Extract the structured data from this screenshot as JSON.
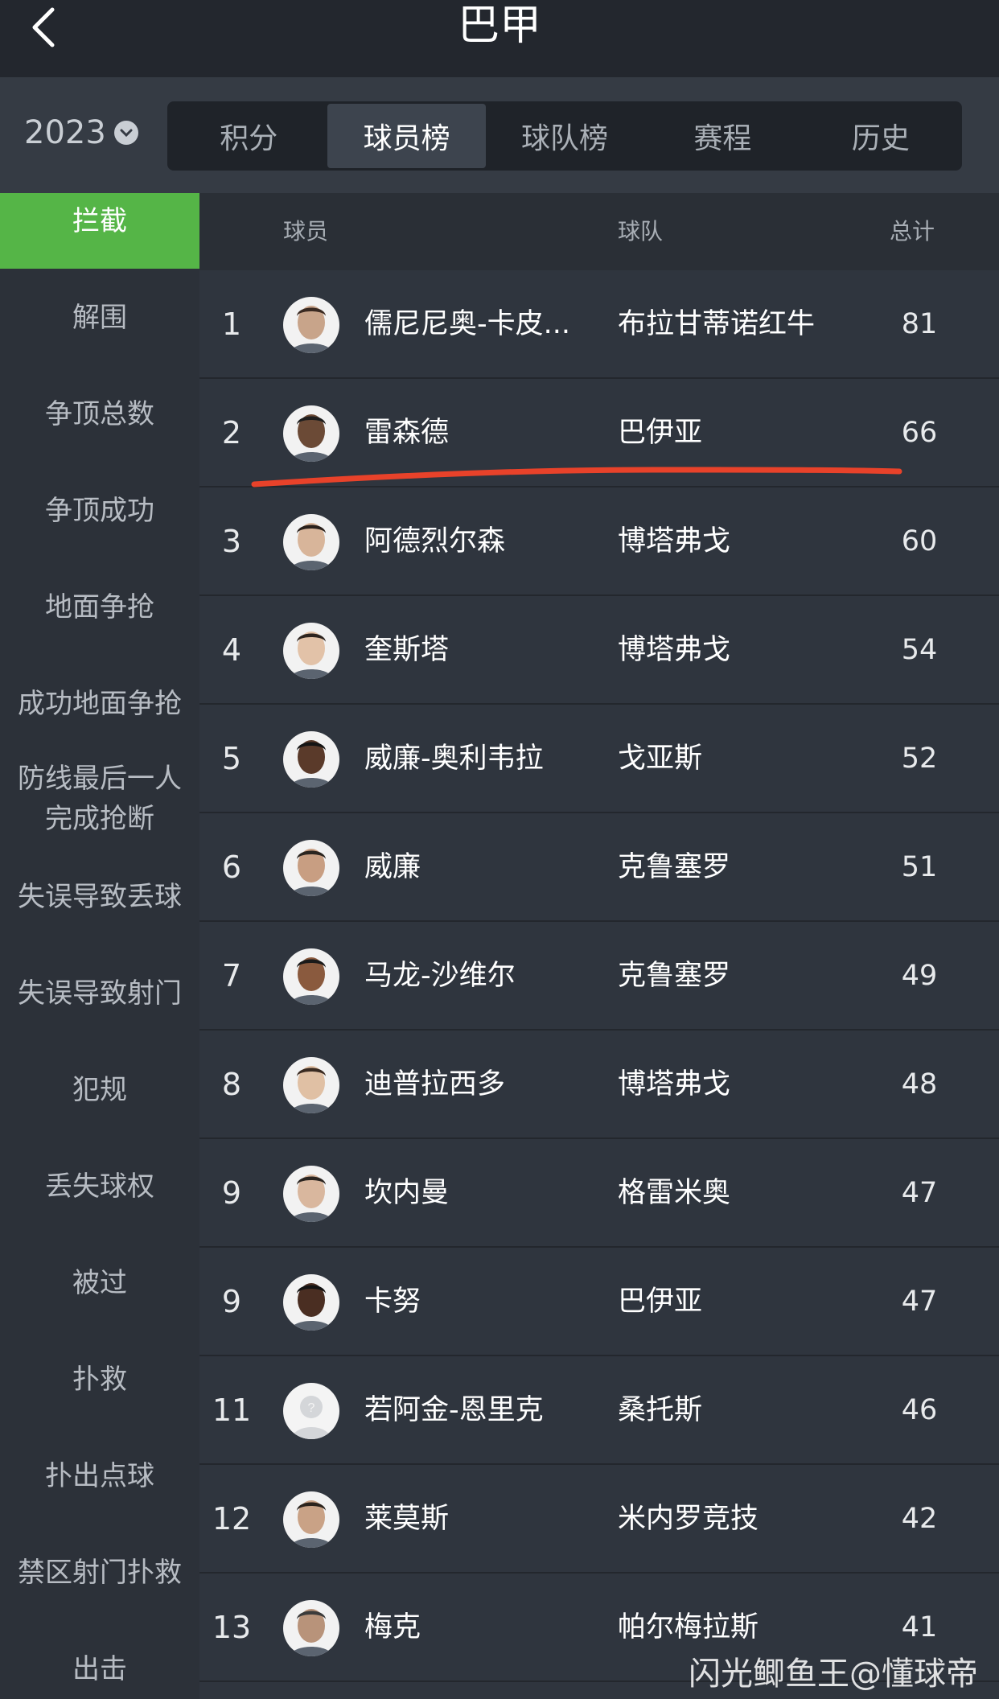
{
  "header": {
    "title": "巴甲"
  },
  "filter": {
    "year": "2023",
    "tabs": [
      {
        "label": "积分",
        "active": false
      },
      {
        "label": "球员榜",
        "active": true
      },
      {
        "label": "球队榜",
        "active": false
      },
      {
        "label": "赛程",
        "active": false
      },
      {
        "label": "历史",
        "active": false
      }
    ]
  },
  "sidebar": {
    "items": [
      {
        "label": "拦截",
        "active": true
      },
      {
        "label": "解围"
      },
      {
        "label": "争顶总数"
      },
      {
        "label": "争顶成功"
      },
      {
        "label": "地面争抢"
      },
      {
        "label": "成功地面争抢"
      },
      {
        "label": "防线最后一人完成抢断",
        "line1": "防线最后一人",
        "line2": "完成抢断"
      },
      {
        "label": "失误导致丢球"
      },
      {
        "label": "失误导致射门"
      },
      {
        "label": "犯规"
      },
      {
        "label": "丢失球权"
      },
      {
        "label": "被过"
      },
      {
        "label": "扑救"
      },
      {
        "label": "扑出点球"
      },
      {
        "label": "禁区射门扑救"
      },
      {
        "label": "出击"
      }
    ]
  },
  "table": {
    "columns": {
      "player": "球员",
      "team": "球队",
      "total": "总计"
    },
    "rows": [
      {
        "rank": "1",
        "player": "儒尼尼奥-卡皮...",
        "team": "布拉甘蒂诺红牛",
        "total": "81"
      },
      {
        "rank": "2",
        "player": "雷森德",
        "team": "巴伊亚",
        "total": "66"
      },
      {
        "rank": "3",
        "player": "阿德烈尔森",
        "team": "博塔弗戈",
        "total": "60"
      },
      {
        "rank": "4",
        "player": "奎斯塔",
        "team": "博塔弗戈",
        "total": "54"
      },
      {
        "rank": "5",
        "player": "威廉-奥利韦拉",
        "team": "戈亚斯",
        "total": "52"
      },
      {
        "rank": "6",
        "player": "威廉",
        "team": "克鲁塞罗",
        "total": "51"
      },
      {
        "rank": "7",
        "player": "马龙-沙维尔",
        "team": "克鲁塞罗",
        "total": "49"
      },
      {
        "rank": "8",
        "player": "迪普拉西多",
        "team": "博塔弗戈",
        "total": "48"
      },
      {
        "rank": "9",
        "player": "坎内曼",
        "team": "格雷米奥",
        "total": "47"
      },
      {
        "rank": "9",
        "player": "卡努",
        "team": "巴伊亚",
        "total": "47"
      },
      {
        "rank": "11",
        "player": "若阿金-恩里克",
        "team": "桑托斯",
        "total": "46"
      },
      {
        "rank": "12",
        "player": "莱莫斯",
        "team": "米内罗竞技",
        "total": "42"
      },
      {
        "rank": "13",
        "player": "梅克",
        "team": "帕尔梅拉斯",
        "total": "41"
      }
    ]
  },
  "watermark": "闪光鲫鱼王@懂球帝",
  "colors": {
    "accent": "#55b547",
    "highlight_mark": "#e8422a"
  }
}
